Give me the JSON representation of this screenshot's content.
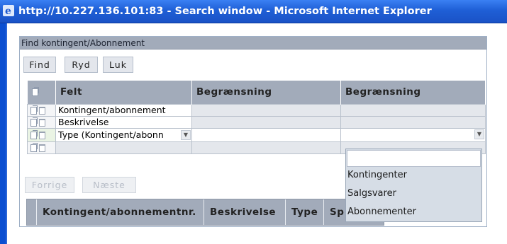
{
  "window": {
    "title": "http://10.227.136.101:83 - Search window - Microsoft Internet Explorer"
  },
  "panel": {
    "header": "Find kontingent/Abonnement",
    "buttons": {
      "find": "Find",
      "clear": "Ryd",
      "close": "Luk"
    }
  },
  "filter_grid": {
    "headers": [
      "Felt",
      "Begrænsning",
      "Begrænsning"
    ],
    "rows": [
      {
        "field": "Kontingent/abonnement"
      },
      {
        "field": "Beskrivelse"
      },
      {
        "field": "Type (Kontingent/abonn"
      },
      {
        "field": ""
      }
    ]
  },
  "dropdown": {
    "options": [
      "Kontingenter",
      "Salgsvarer",
      "Abonnementer"
    ]
  },
  "pager": {
    "prev": "Forrige",
    "next": "Næste"
  },
  "results": {
    "headers": [
      "Kontingent/abonnementnr.",
      "Beskrivelse",
      "Type",
      "Sp"
    ]
  },
  "icons": {
    "browser": "ie-icon",
    "copy": "copy-icon",
    "delete": "trash-icon",
    "dropdown": "chevron-down-icon"
  }
}
